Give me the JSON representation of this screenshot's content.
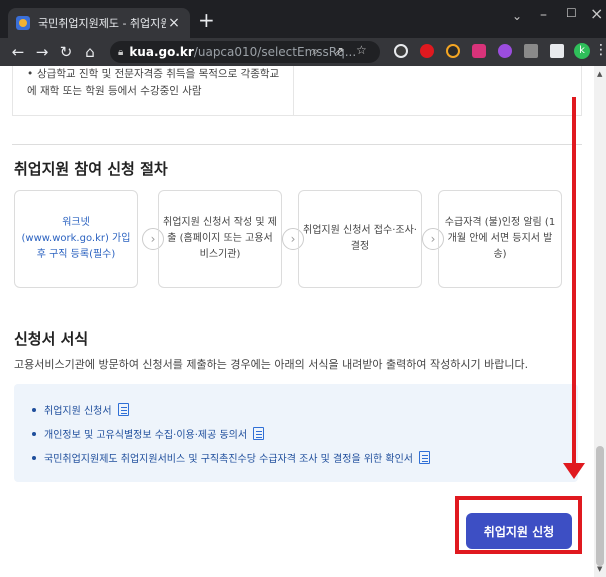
{
  "browser": {
    "tab_title": "국민취업지원제도 - 취업지원관리",
    "tab_close": "×",
    "new_tab": "+",
    "url_host": "kua.go.kr",
    "url_path": "/uapca010/selectEmssRq...",
    "profile_initial": "k"
  },
  "page": {
    "top_text": "상급학교 진학 및 전문자격증 취득을 목적으로 각종학교에 재학 또는 학원 등에서 수강중인 사람",
    "procedure_title": "취업지원 참여 신청 절차",
    "steps": [
      {
        "text": "워크넷 (www.work.go.kr) 가입 후 구직 등록(필수)"
      },
      {
        "text": "취업지원 신청서 작성 및 제출 (홈페이지 또는 고용서비스기관)"
      },
      {
        "text": "취업지원 신청서 접수·조사·결정"
      },
      {
        "text": "수급자격 (불)인정 알림 (1개월 안에 서면 등지서 발송)"
      }
    ],
    "forms_title": "신청서 서식",
    "forms_desc": "고용서비스기관에 방문하여 신청서를 제출하는 경우에는 아래의 서식을 내려받아 출력하여 작성하시기 바랍니다.",
    "forms": [
      "취업지원 신청서",
      "개인정보 및 고유식별정보 수집·이용·제공 동의서",
      "국민취업지원제도 취업지원서비스 및 구직촉진수당 수급자격 조사 및 결정을 위한 확인서"
    ],
    "apply_button": "취업지원 신청"
  },
  "colors": {
    "accent": "#3d4fc4",
    "highlight": "#e0191f",
    "link": "#1f4e9c"
  }
}
